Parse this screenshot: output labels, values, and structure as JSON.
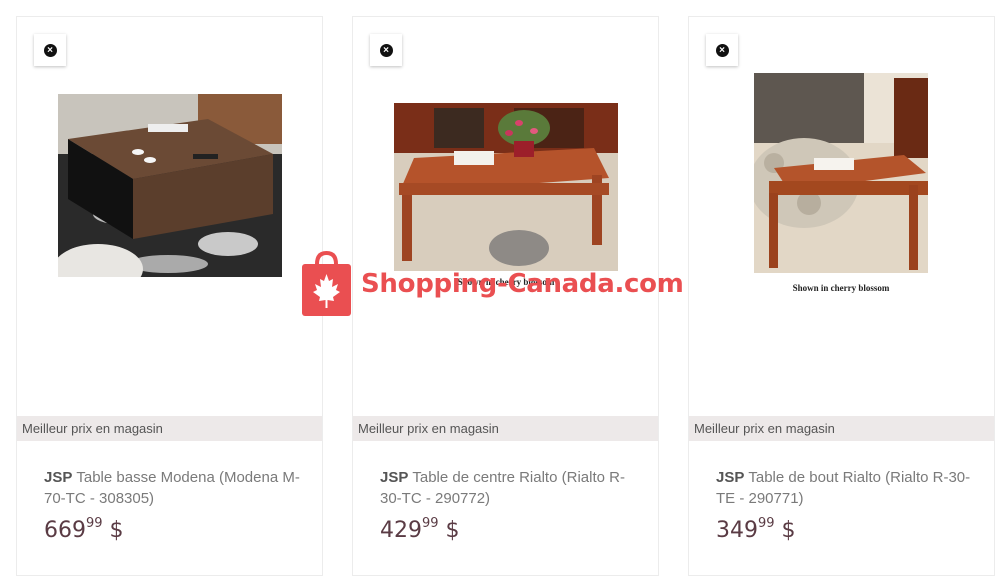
{
  "products": [
    {
      "badge": "Meilleur prix en magasin",
      "brand": "JSP",
      "name": "Table basse Modena (Modena M-70-TC - 308305)",
      "price_whole": "669",
      "price_cents": "99",
      "currency": "$",
      "image_caption": ""
    },
    {
      "badge": "Meilleur prix en magasin",
      "brand": "JSP",
      "name": "Table de centre Rialto (Rialto R-30-TC - 290772)",
      "price_whole": "429",
      "price_cents": "99",
      "currency": "$",
      "image_caption": "Shown in cherry blossom"
    },
    {
      "badge": "Meilleur prix en magasin",
      "brand": "JSP",
      "name": "Table de bout Rialto (Rialto R-30-TE - 290771)",
      "price_whole": "349",
      "price_cents": "99",
      "currency": "$",
      "image_caption": "Shown in cherry blossom"
    }
  ],
  "watermark": {
    "text": "Shopping-Canada.com",
    "color": "#ea4f51"
  },
  "close_icon": "close-icon"
}
